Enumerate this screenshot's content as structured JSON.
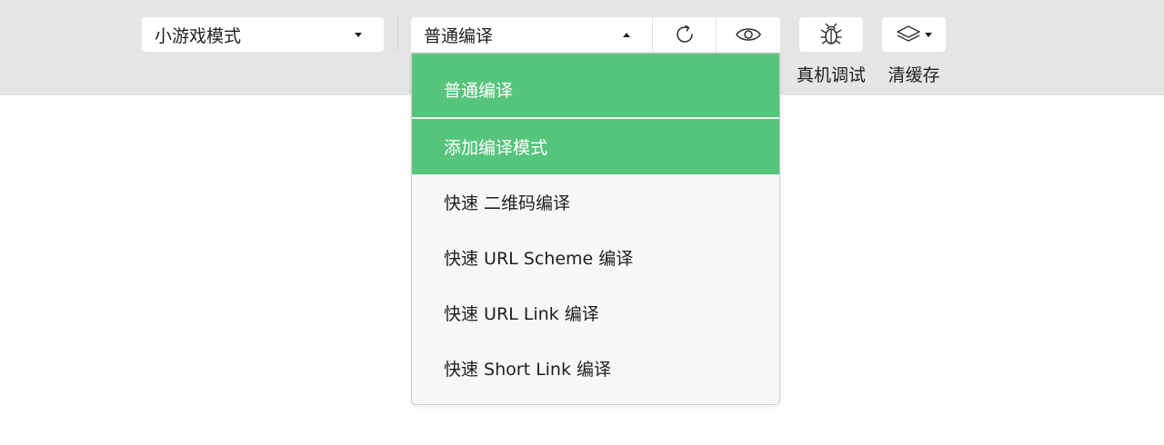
{
  "toolbar": {
    "mode_select": {
      "label": "小游戏模式"
    },
    "compile_select": {
      "label": "普通编译"
    },
    "refresh_icon": "refresh-icon",
    "preview_icon": "eye-icon",
    "debug": {
      "icon": "bug-icon",
      "label": "真机调试"
    },
    "cache": {
      "icon": "layers-icon",
      "label": "清缓存"
    }
  },
  "compile_menu": {
    "items": [
      {
        "label": "普通编译",
        "highlighted": true
      },
      {
        "label": "添加编译模式",
        "highlighted": true
      },
      {
        "label": "快速 二维码编译",
        "highlighted": false
      },
      {
        "label": "快速 URL Scheme 编译",
        "highlighted": false
      },
      {
        "label": "快速 URL Link 编译",
        "highlighted": false
      },
      {
        "label": "快速 Short Link 编译",
        "highlighted": false
      }
    ]
  },
  "colors": {
    "toolbar_bg": "#e5e5e5",
    "highlight_green": "#57c47c",
    "menu_bg": "#f7f7f7"
  }
}
